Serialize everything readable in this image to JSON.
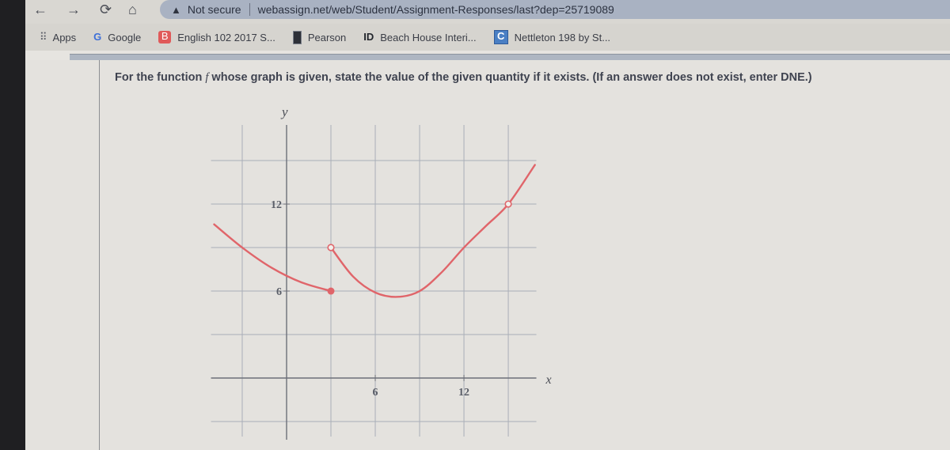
{
  "browser": {
    "nav": {
      "back_icon": "←",
      "forward_icon": "→",
      "reload_icon": "⟳",
      "home_icon": "⌂"
    },
    "security_label": "Not secure",
    "url": "webassign.net/web/Student/Assignment-Responses/last?dep=25719089",
    "bookmarks": [
      {
        "label": "Apps",
        "icon": "apps-grid-icon"
      },
      {
        "label": "Google",
        "icon": "google-icon"
      },
      {
        "label": "English 102 2017 S...",
        "icon": "blogger-icon"
      },
      {
        "label": "Pearson",
        "icon": "pearson-icon"
      },
      {
        "label": "Beach House Interi...",
        "icon": "id-icon"
      },
      {
        "label": "Nettleton 198 by St...",
        "icon": "c-icon"
      }
    ]
  },
  "question": {
    "prefix": "For the function ",
    "func": "f",
    "suffix": " whose graph is given, state the value of the given quantity if it exists. (If an answer does not exist, enter DNE.)"
  },
  "chart_data": {
    "type": "line",
    "title": "",
    "xlabel": "x",
    "ylabel": "y",
    "xlim": [
      -5,
      17.5
    ],
    "ylim": [
      -4,
      17
    ],
    "grid": true,
    "grid_step": 3,
    "x_ticks": [
      {
        "value": 6,
        "label": "6"
      },
      {
        "value": 12,
        "label": "12"
      }
    ],
    "y_ticks": [
      {
        "value": 6,
        "label": "6"
      },
      {
        "value": 12,
        "label": "12"
      }
    ],
    "color": "#e0656a",
    "series": [
      {
        "name": "piece-1",
        "points": [
          [
            -4.9,
            10.6
          ],
          [
            -3,
            9
          ],
          [
            -1,
            7.6
          ],
          [
            1,
            6.6
          ],
          [
            3,
            6
          ]
        ]
      },
      {
        "name": "piece-2",
        "points": [
          [
            3,
            9
          ],
          [
            4.5,
            7
          ],
          [
            6,
            5.9
          ],
          [
            7.5,
            5.6
          ],
          [
            9,
            6
          ],
          [
            10.5,
            7.3
          ],
          [
            12,
            9
          ],
          [
            13.5,
            10.5
          ],
          [
            15,
            12
          ],
          [
            16.8,
            14.7
          ]
        ]
      }
    ],
    "markers": [
      {
        "x": 3,
        "y": 6,
        "type": "closed"
      },
      {
        "x": 3,
        "y": 9,
        "type": "open"
      },
      {
        "x": 15,
        "y": 12,
        "type": "open"
      }
    ]
  }
}
